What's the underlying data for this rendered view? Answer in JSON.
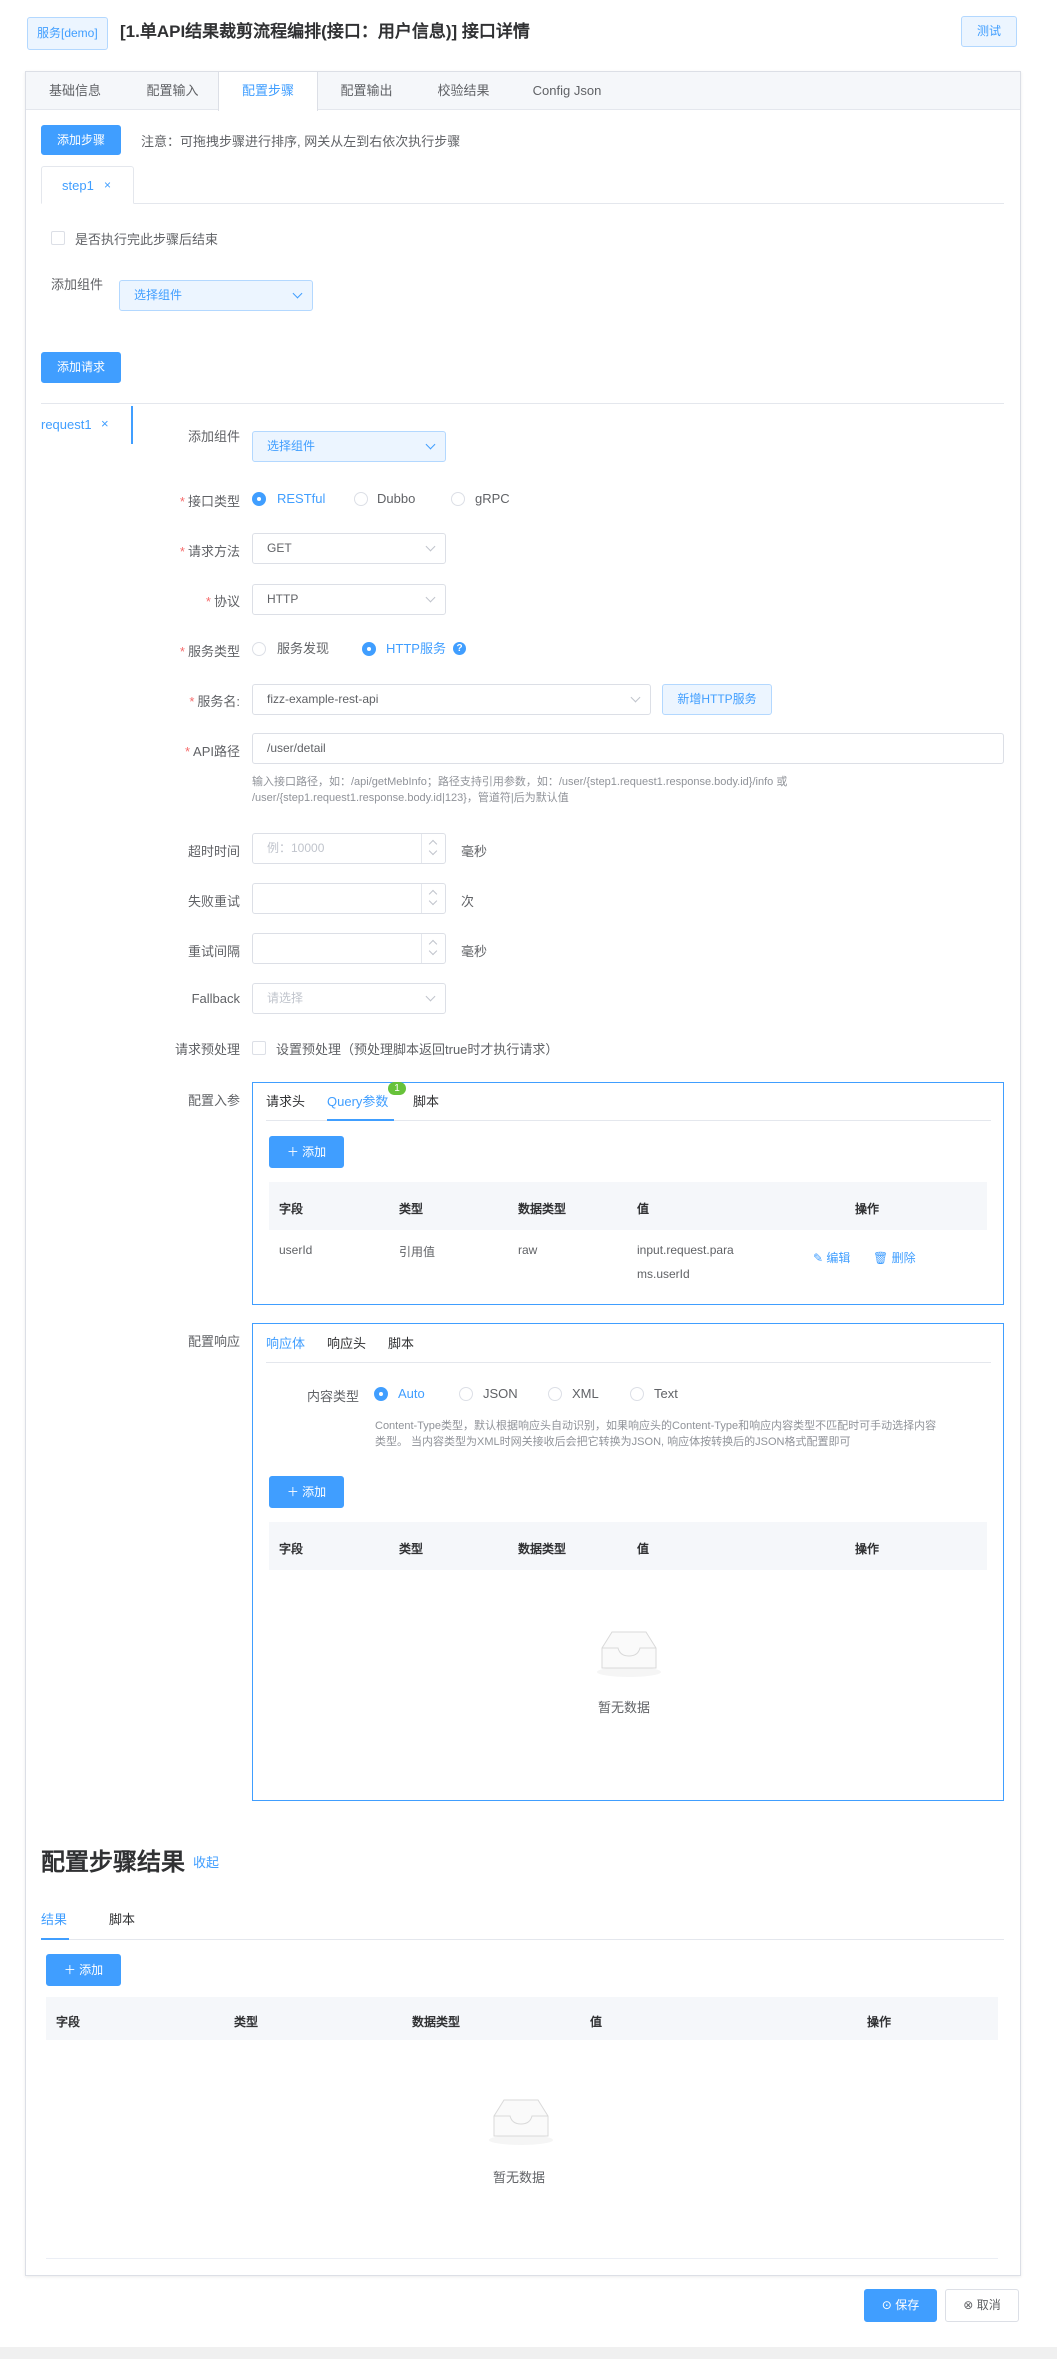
{
  "header": {
    "service_tag": "服务[demo]",
    "title": "[1.单API结果裁剪流程编排(接口：用户信息)] 接口详情",
    "test_button": "测试"
  },
  "tabs": [
    "基础信息",
    "配置输入",
    "配置步骤",
    "配置输出",
    "校验结果",
    "Config Json"
  ],
  "step": {
    "add_step": "添加步骤",
    "note": "注意：可拖拽步骤进行排序, 网关从左到右依次执行步骤",
    "tab_label": "step1",
    "finish_checkbox": "是否执行完此步骤后结束",
    "add_component_label": "添加组件",
    "component_placeholder": "选择组件",
    "add_request": "添加请求"
  },
  "request": {
    "tab_label": "request1",
    "add_component_label": "添加组件",
    "component_placeholder": "选择组件",
    "interface_type": {
      "label": "接口类型",
      "options": [
        "RESTful",
        "Dubbo",
        "gRPC"
      ],
      "selected": "RESTful"
    },
    "method": {
      "label": "请求方法",
      "value": "GET"
    },
    "protocol": {
      "label": "协议",
      "value": "HTTP"
    },
    "service_type": {
      "label": "服务类型",
      "options": [
        "服务发现",
        "HTTP服务"
      ],
      "selected": "HTTP服务"
    },
    "service_name": {
      "label": "服务名:",
      "value": "fizz-example-rest-api",
      "add_button": "新增HTTP服务"
    },
    "api_path": {
      "label": "API路径",
      "value": "/user/detail",
      "hint1": "输入接口路径，如：/api/getMebInfo；路径支持引用参数，如：/user/{step1.request1.response.body.id}/info 或",
      "hint2": "/user/{step1.request1.response.body.id|123}，管道符|后为默认值"
    },
    "timeout": {
      "label": "超时时间",
      "placeholder": "例：10000",
      "unit": "毫秒"
    },
    "retry": {
      "label": "失败重试",
      "unit": "次"
    },
    "retry_interval": {
      "label": "重试间隔",
      "unit": "毫秒"
    },
    "fallback": {
      "label": "Fallback",
      "placeholder": "请选择"
    },
    "preprocess": {
      "label": "请求预处理",
      "text": "设置预处理（预处理脚本返回true时才执行请求）"
    }
  },
  "input_params": {
    "label": "配置入参",
    "tabs": [
      "请求头",
      "Query参数",
      "脚本"
    ],
    "badge": "1",
    "add_button": "添加",
    "columns": [
      "字段",
      "类型",
      "数据类型",
      "值",
      "操作"
    ],
    "rows": [
      {
        "field": "userId",
        "type": "引用值",
        "data_type": "raw",
        "value1": "input.request.para",
        "value2": "ms.userId",
        "edit": "编辑",
        "delete": "删除"
      }
    ]
  },
  "response_config": {
    "label": "配置响应",
    "tabs": [
      "响应体",
      "响应头",
      "脚本"
    ],
    "content_type_label": "内容类型",
    "content_types": [
      "Auto",
      "JSON",
      "XML",
      "Text"
    ],
    "selected": "Auto",
    "hint1": "Content-Type类型，默认根据响应头自动识别，如果响应头的Content-Type和响应内容类型不匹配时可手动选择内容",
    "hint2": "类型。 当内容类型为XML时网关接收后会把它转换为JSON, 响应体按转换后的JSON格式配置即可",
    "add_button": "添加",
    "columns": [
      "字段",
      "类型",
      "数据类型",
      "值",
      "操作"
    ],
    "empty": "暂无数据"
  },
  "step_result": {
    "title": "配置步骤结果",
    "collapse": "收起",
    "tabs": [
      "结果",
      "脚本"
    ],
    "add_button": "添加",
    "columns": [
      "字段",
      "类型",
      "数据类型",
      "值",
      "操作"
    ],
    "empty": "暂无数据"
  },
  "footer": {
    "save": "保存",
    "cancel": "取消"
  }
}
